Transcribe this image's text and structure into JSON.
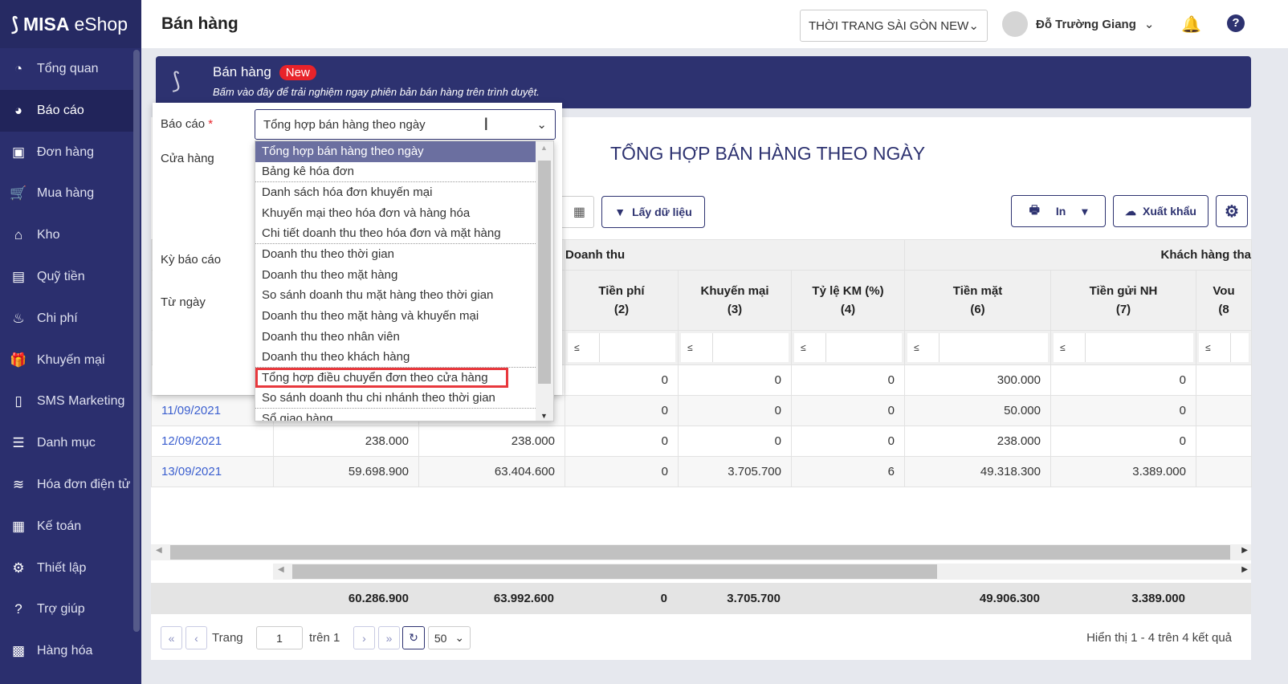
{
  "app": {
    "logo": "MISA eShop",
    "logo_a": "MISA",
    "logo_b": "eShop"
  },
  "sidebar": {
    "items": [
      {
        "label": "Tổng quan",
        "icon": "dashboard-icon",
        "glyph": "◔"
      },
      {
        "label": "Báo cáo",
        "icon": "pie-chart-icon",
        "glyph": "◕"
      },
      {
        "label": "Đơn hàng",
        "icon": "order-icon",
        "glyph": "▣"
      },
      {
        "label": "Mua hàng",
        "icon": "cart-icon",
        "glyph": "🛒"
      },
      {
        "label": "Kho",
        "icon": "warehouse-icon",
        "glyph": "⌂"
      },
      {
        "label": "Quỹ tiền",
        "icon": "safe-icon",
        "glyph": "▤"
      },
      {
        "label": "Chi phí",
        "icon": "expense-icon",
        "glyph": "♨"
      },
      {
        "label": "Khuyến mại",
        "icon": "gift-icon",
        "glyph": "🎁"
      },
      {
        "label": "SMS Marketing",
        "icon": "phone-icon",
        "glyph": "▯"
      },
      {
        "label": "Danh mục",
        "icon": "list-icon",
        "glyph": "☰"
      },
      {
        "label": "Hóa đơn điện tử",
        "icon": "einvoice-icon",
        "glyph": "≋"
      },
      {
        "label": "Kế toán",
        "icon": "calculator-icon",
        "glyph": "▦"
      },
      {
        "label": "Thiết lập",
        "icon": "gear-icon",
        "glyph": "⚙"
      },
      {
        "label": "Trợ giúp",
        "icon": "help-icon",
        "glyph": "?"
      },
      {
        "label": "Hàng hóa",
        "icon": "boxes-icon",
        "glyph": "▩"
      }
    ]
  },
  "header": {
    "title": "Bán hàng",
    "store": "THỜI TRANG SÀI GÒN NEW",
    "user": "Đỗ Trường Giang"
  },
  "banner": {
    "title": "Bán hàng",
    "badge": "New",
    "subtitle": "Bấm vào đây để trải nghiệm ngay phiên bản bán hàng trên trình duyệt."
  },
  "filter": {
    "report_label": "Báo cáo",
    "required": "*",
    "report_value": "Tổng hợp bán hàng theo ngày",
    "store_label": "Cửa hàng",
    "period_label": "Kỳ báo cáo",
    "from_label": "Từ ngày",
    "options": [
      "Tổng hợp bán hàng theo ngày",
      "Bảng kê hóa đơn",
      "Danh sách hóa đơn khuyến mại",
      "Khuyến mại theo hóa đơn và hàng hóa",
      "Chi tiết doanh thu theo hóa đơn và mặt hàng",
      "Doanh thu theo thời gian",
      "Doanh thu theo mặt hàng",
      "So sánh doanh thu mặt hàng theo thời gian",
      "Doanh thu theo mặt hàng và khuyến mại",
      "Doanh thu theo nhân viên",
      "Doanh thu theo khách hàng",
      "Tổng hợp điều chuyển đơn theo cửa hàng",
      "So sánh doanh thu chi nhánh theo thời gian",
      "Sổ giao hàng"
    ]
  },
  "report": {
    "title": "TỔNG HỢP BÁN HÀNG THEO NGÀY",
    "get_data": "Lấy dữ liệu",
    "print": "In",
    "export": "Xuất khẩu",
    "group1": "Doanh thu",
    "group2": "Khách hàng tha",
    "columns": [
      {
        "name": "Tiền phí",
        "num": "(2)"
      },
      {
        "name": "Khuyến mại",
        "num": "(3)"
      },
      {
        "name": "Tỷ lệ KM (%)",
        "num": "(4)"
      },
      {
        "name": "Tiền mặt",
        "num": "(6)"
      },
      {
        "name": "Tiền gửi NH",
        "num": "(7)"
      },
      {
        "name": "Vou",
        "num": "(8"
      }
    ],
    "filter_op": "≤",
    "rows": [
      {
        "date": "",
        "c1": "",
        "c2": "",
        "c3": "0",
        "c4": "0",
        "c5": "0",
        "c6": "300.000",
        "c7": "0"
      },
      {
        "date": "11/09/2021",
        "c1": "",
        "c2": "",
        "c3": "0",
        "c4": "0",
        "c5": "0",
        "c6": "50.000",
        "c7": "0"
      },
      {
        "date": "12/09/2021",
        "c1": "238.000",
        "c2": "238.000",
        "c3": "0",
        "c4": "0",
        "c5": "0",
        "c6": "238.000",
        "c7": "0"
      },
      {
        "date": "13/09/2021",
        "c1": "59.698.900",
        "c2": "63.404.600",
        "c3": "0",
        "c4": "3.705.700",
        "c5": "6",
        "c6": "49.318.300",
        "c7": "3.389.000"
      }
    ],
    "totals": {
      "c1": "60.286.900",
      "c2": "63.992.600",
      "c3": "0",
      "c4": "3.705.700",
      "c6": "49.906.300",
      "c7": "3.389.000"
    }
  },
  "pagination": {
    "page_label": "Trang",
    "page": "1",
    "of": "trên 1",
    "page_size": "50",
    "summary": "Hiển thị 1 - 4 trên 4 kết quả"
  }
}
